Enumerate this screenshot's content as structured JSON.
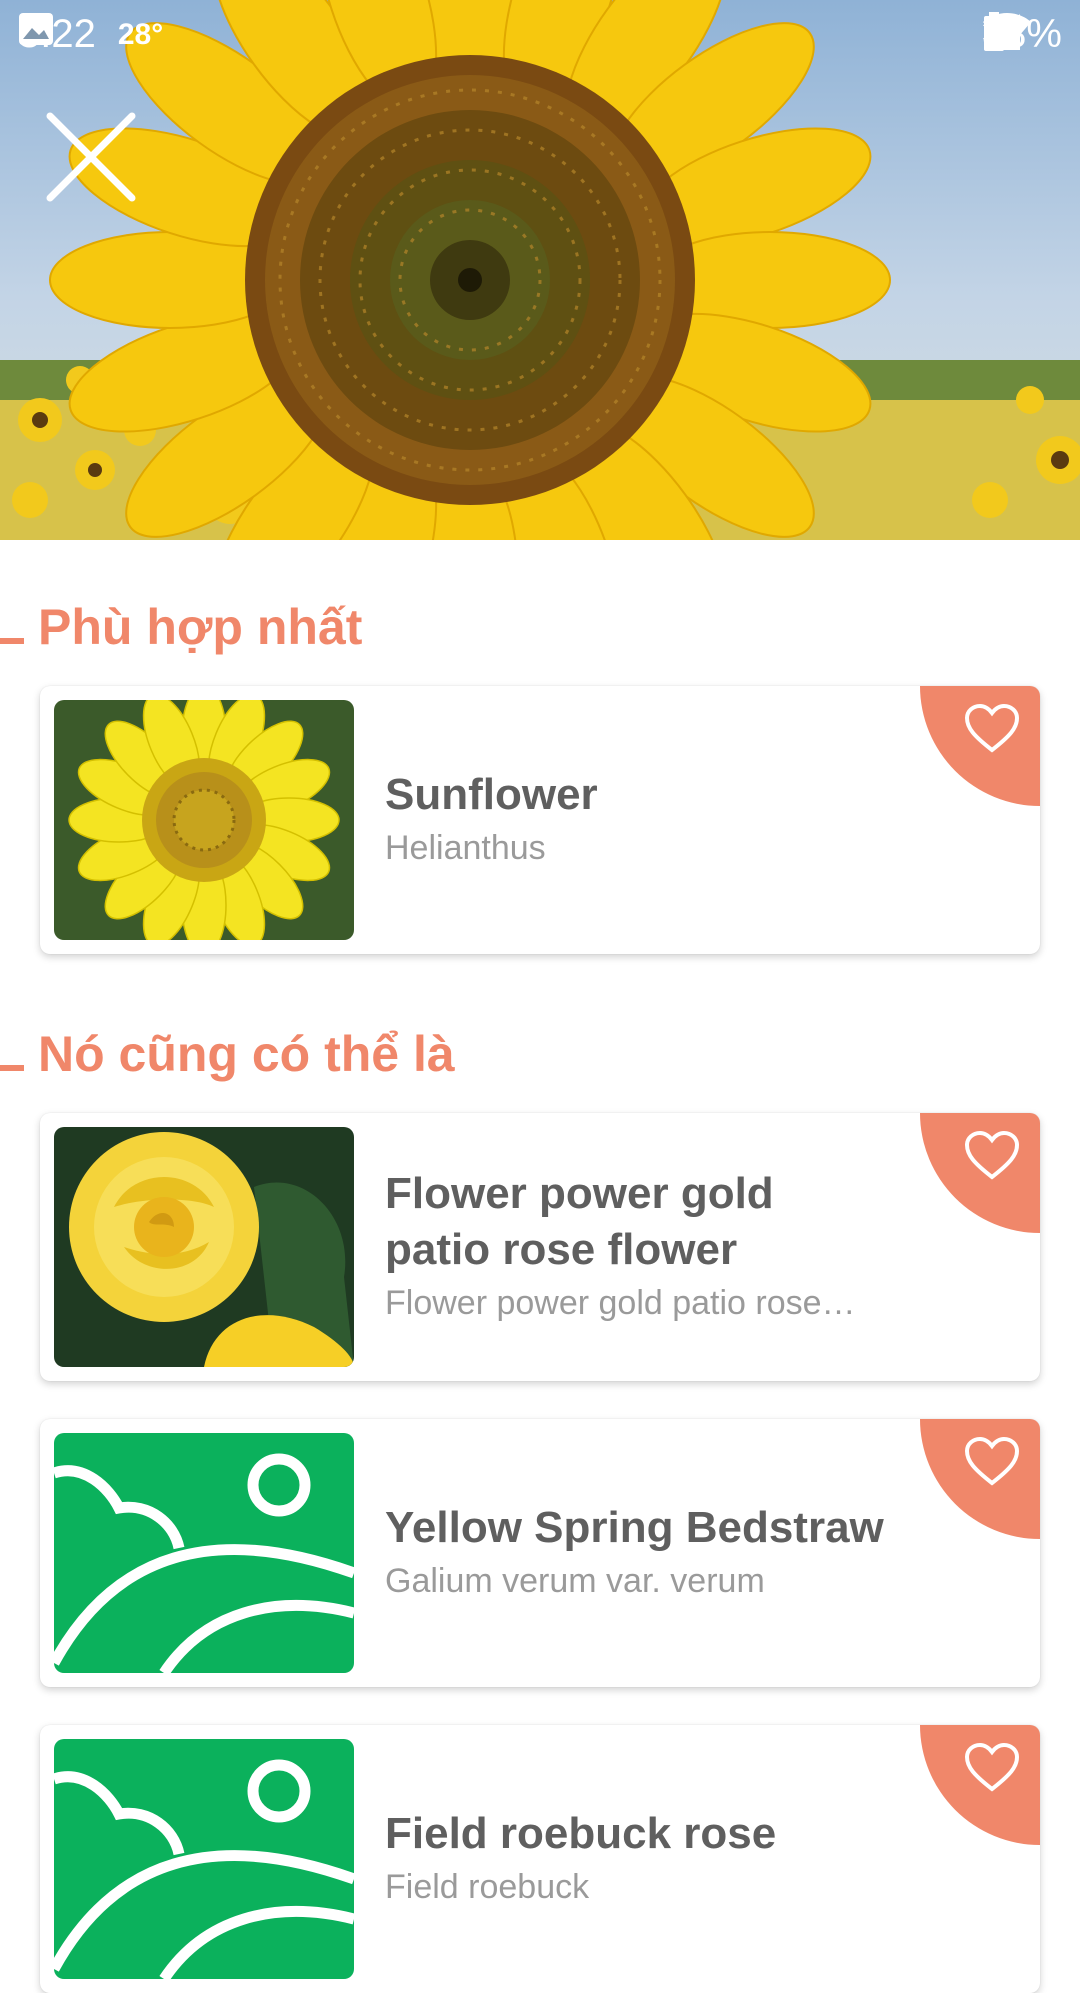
{
  "status_bar": {
    "time": "8:22",
    "temperature": "28°",
    "battery": "88%",
    "icons": [
      "image-icon",
      "alarm-icon",
      "location-icon",
      "data-arrows-icon",
      "wifi-icon",
      "cell-signal-icon",
      "battery-icon"
    ]
  },
  "colors": {
    "accent": "#f0876a",
    "placeholder_green": "#0bb15c",
    "title_text": "#5f5f5f",
    "subtitle_text": "#9a9a9a"
  },
  "best_match": {
    "heading": "Phù hợp nhất",
    "items": [
      {
        "title": "Sunflower",
        "subtitle": "Helianthus",
        "image": "sunflower-photo"
      }
    ]
  },
  "alternatives": {
    "heading": "Nó cũng có thể là",
    "items": [
      {
        "title": "Flower power gold patio rose  flower",
        "subtitle": "Flower power gold patio rose…",
        "image": "yellow-rose-photo"
      },
      {
        "title": "Yellow Spring Bedstraw",
        "subtitle": "Galium verum var. verum",
        "image": "placeholder-image-icon"
      },
      {
        "title": "Field roebuck rose",
        "subtitle": "Field roebuck",
        "image": "placeholder-image-icon"
      }
    ]
  }
}
